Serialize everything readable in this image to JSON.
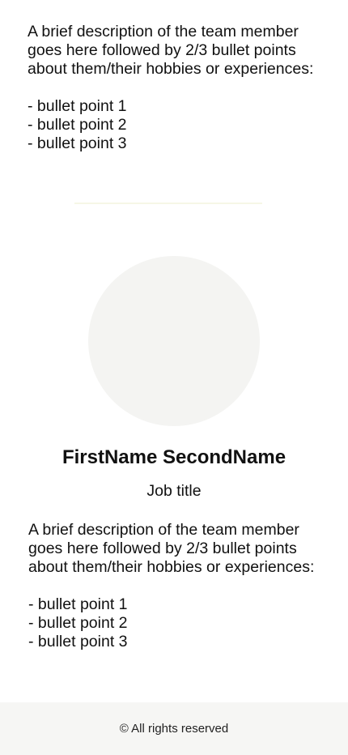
{
  "members": [
    {
      "description": "A brief description of the team member goes here followed by 2/3 bullet points about them/their hobbies or experiences:",
      "bullets": [
        "- bullet point 1",
        "- bullet point 2",
        "- bullet point 3"
      ]
    },
    {
      "name": "FirstName SecondName",
      "job_title": "Job title",
      "description": "A brief description of the team member goes here followed by 2/3 bullet points about them/their hobbies or experiences:",
      "bullets": [
        "- bullet point 1",
        "- bullet point 2",
        "- bullet point 3"
      ]
    }
  ],
  "footer": {
    "text": "© All rights reserved"
  },
  "colors": {
    "avatar_placeholder": "#f4f4f2",
    "divider": "#f6f7e6",
    "footer_background": "#f6f6f4"
  }
}
